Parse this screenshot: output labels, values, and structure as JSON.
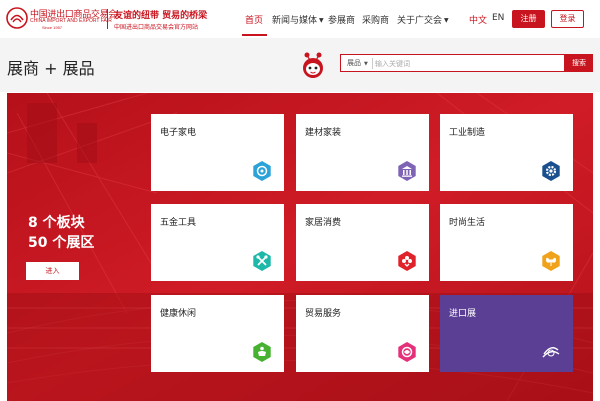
{
  "header": {
    "logo_cn": "中国进出口商品交易会",
    "logo_en": "CHINA IMPORT AND EXPORT FAIR",
    "logo_since": "Since 1957",
    "slogan": "友谊的纽带 贸易的桥梁",
    "slogan_sub": "中国进出口商品交易会官方网站",
    "nav": [
      {
        "label": "首页",
        "active": true
      },
      {
        "label": "新闻与媒体"
      },
      {
        "label": "参展商"
      },
      {
        "label": "采购商"
      },
      {
        "label": "关于广交会"
      }
    ],
    "lang_cn": "中文",
    "lang_en": "EN",
    "register_label": "注册",
    "login_label": "登录"
  },
  "title_bar": {
    "title": "展商 + 展品",
    "search_category": "展品",
    "search_placeholder": "输入关键词",
    "search_button": "搜索"
  },
  "panel": {
    "summary_line1": "8 个板块",
    "summary_line2": "50 个展区",
    "enter_label": "进入",
    "cards": [
      {
        "label": "电子家电",
        "icon": "appliance-icon",
        "color": "#2ba3d8"
      },
      {
        "label": "建材家装",
        "icon": "building-icon",
        "color": "#7f63b5"
      },
      {
        "label": "工业制造",
        "icon": "gear-icon",
        "color": "#1a4f8f"
      },
      {
        "label": "五金工具",
        "icon": "tools-icon",
        "color": "#1db8a8"
      },
      {
        "label": "家居消费",
        "icon": "flower-icon",
        "color": "#e0222a"
      },
      {
        "label": "时尚生活",
        "icon": "butterfly-icon",
        "color": "#f0a21a"
      },
      {
        "label": "健康休闲",
        "icon": "health-icon",
        "color": "#47b232"
      },
      {
        "label": "贸易服务",
        "icon": "service-icon",
        "color": "#e4317a"
      },
      {
        "label": "进口展",
        "icon": "import-expo-icon",
        "color": "#ffffff"
      }
    ]
  },
  "colors": {
    "brand": "#c8141e",
    "purple": "#5b3f95"
  }
}
